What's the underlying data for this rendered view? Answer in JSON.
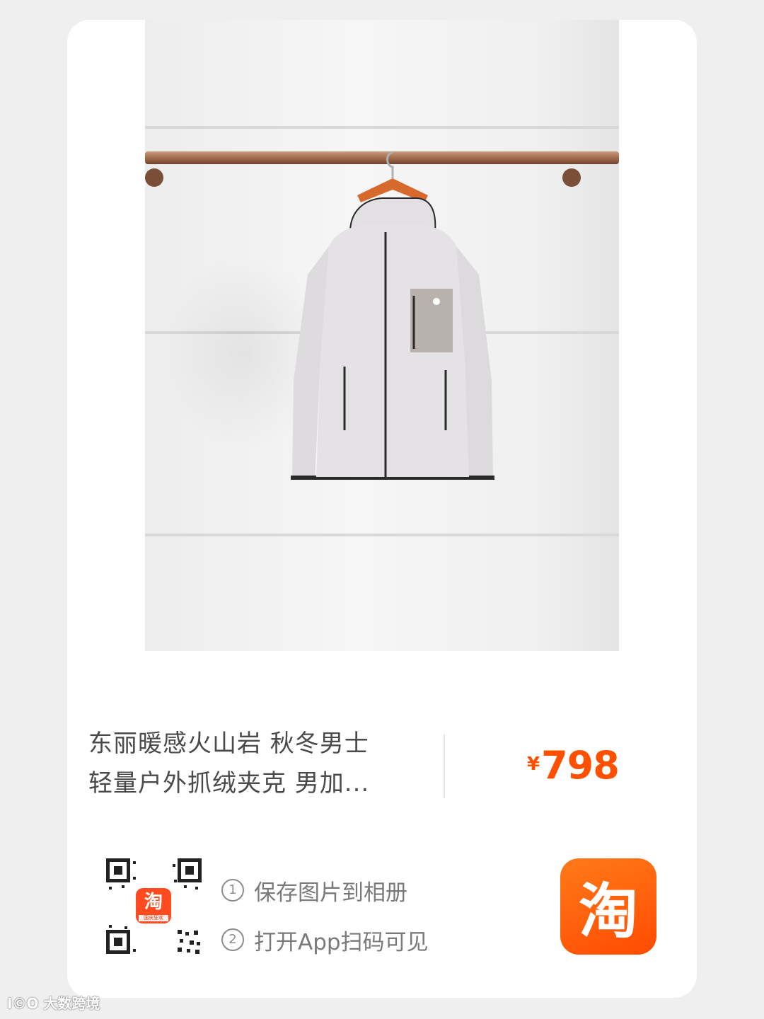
{
  "product": {
    "title_line1": "东丽暖感火山岩 秋冬男士",
    "title_line2": "轻量户外抓绒夹克 男加...",
    "price_currency": "¥",
    "price_value": "798",
    "price_color": "#ff5000"
  },
  "qr": {
    "center_badge_glyph": "淘",
    "center_badge_caption": "国庆狂欢"
  },
  "steps": [
    {
      "number": "1",
      "text": "保存图片到相册"
    },
    {
      "number": "2",
      "text": "打开App扫码可见"
    }
  ],
  "app_button": {
    "glyph": "淘",
    "color": "#ff5000"
  },
  "watermark": {
    "text": "大数跨境",
    "logo_text": "I©O"
  },
  "colors": {
    "page_bg": "#efefef",
    "card_bg": "#ffffff",
    "accent": "#ff5000"
  }
}
